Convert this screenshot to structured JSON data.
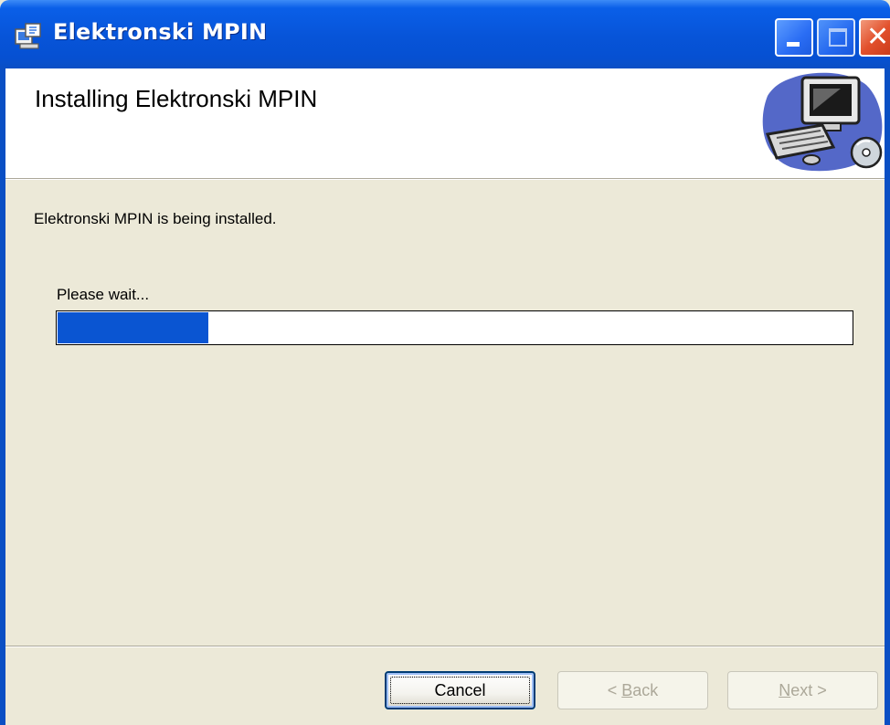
{
  "window": {
    "title": "Elektronski MPIN",
    "icon": "installer-icon",
    "controls": {
      "minimize": "minimize-icon",
      "maximize": "maximize-icon",
      "close": "close-icon"
    },
    "colors": {
      "titlebar": "#0754d8",
      "body": "#ece9d8",
      "progress_fill": "#0a55d2",
      "close_button": "#e2502c"
    }
  },
  "banner": {
    "title": "Installing Elektronski MPIN",
    "art": "computer-with-cd-icon"
  },
  "main": {
    "status": "Elektronski MPIN is being installed.",
    "progress_label": "Please wait...",
    "progress_fraction": 0.19
  },
  "footer": {
    "cancel_label": "Cancel",
    "back_label_prefix": "< ",
    "back_accel": "B",
    "back_label_rest": "ack",
    "next_accel": "N",
    "next_label_rest": "ext >"
  }
}
